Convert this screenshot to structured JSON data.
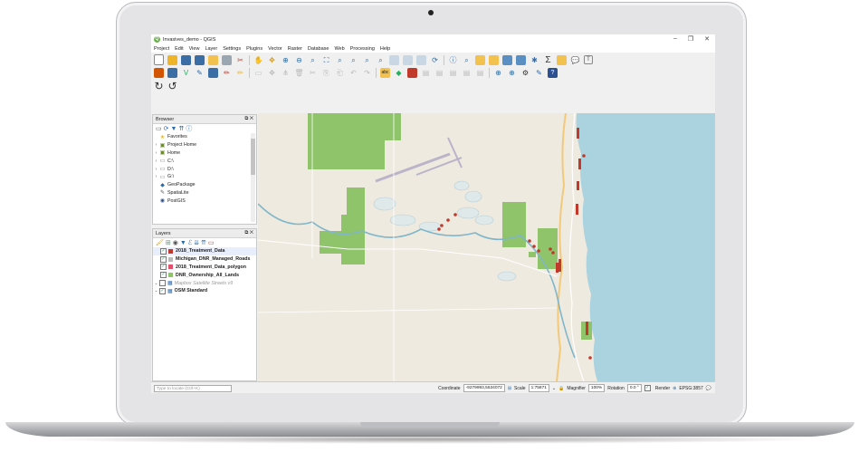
{
  "window": {
    "title": "Invasives_demo - QGIS",
    "controls": [
      "–",
      "❐",
      "✕"
    ]
  },
  "menu": [
    "Project",
    "Edit",
    "View",
    "Layer",
    "Settings",
    "Plugins",
    "Vector",
    "Raster",
    "Database",
    "Web",
    "Processing",
    "Help"
  ],
  "browser": {
    "title": "Browser",
    "items": [
      {
        "label": "Favorites",
        "icon": "star-icon",
        "arrow": ""
      },
      {
        "label": "Project Home",
        "icon": "folder-icon",
        "arrow": "›"
      },
      {
        "label": "Home",
        "icon": "folder-icon",
        "arrow": "›"
      },
      {
        "label": "C:\\",
        "icon": "drive-icon",
        "arrow": "›"
      },
      {
        "label": "D:\\",
        "icon": "drive-icon",
        "arrow": "›"
      },
      {
        "label": "G:\\",
        "icon": "drive-icon",
        "arrow": "›"
      },
      {
        "label": "GeoPackage",
        "icon": "geopackage-icon",
        "arrow": ""
      },
      {
        "label": "SpatiaLite",
        "icon": "spatialite-icon",
        "arrow": ""
      },
      {
        "label": "PostGIS",
        "icon": "postgis-icon",
        "arrow": ""
      }
    ]
  },
  "layers": {
    "title": "Layers",
    "items": [
      {
        "label": "2018_Treatment_Data",
        "style": "bold",
        "checked": true,
        "swatch": "#c0392b",
        "indent": 1
      },
      {
        "label": "Michigan_DNR_Managed_Roads",
        "style": "bold",
        "checked": true,
        "swatch": "#bbbbbb",
        "indent": 1
      },
      {
        "label": "2018_Treatment_Data_polygon",
        "style": "bold",
        "checked": true,
        "swatch": "#e0506a",
        "indent": 1
      },
      {
        "label": "DNR_Ownership_All_Lands",
        "style": "bold",
        "checked": true,
        "swatch": "#8fc46a",
        "indent": 1
      },
      {
        "label": "Mapbox Satellite Streets v9",
        "style": "muted",
        "checked": false,
        "swatch": "",
        "indent": 0
      },
      {
        "label": "OSM Standard",
        "style": "bold",
        "checked": true,
        "swatch": "",
        "indent": 0
      }
    ]
  },
  "status": {
    "locator_placeholder": "Type to locate (Ctrl+K)",
    "coordinate_label": "Coordinate",
    "coordinate_value": "-9279993,5534072",
    "scale_label": "Scale",
    "scale_value": "1:75871",
    "magnifier_label": "Magnifier",
    "magnifier_value": "100%",
    "rotation_label": "Rotation",
    "rotation_value": "0.0 °",
    "render_label": "Render",
    "crs": "EPSG:3857"
  },
  "colors": {
    "water": "#aad3df",
    "land": "#efeae0",
    "public_land": "#8fc46a",
    "treatment": "#c0392b",
    "river": "#7fb6c9"
  }
}
